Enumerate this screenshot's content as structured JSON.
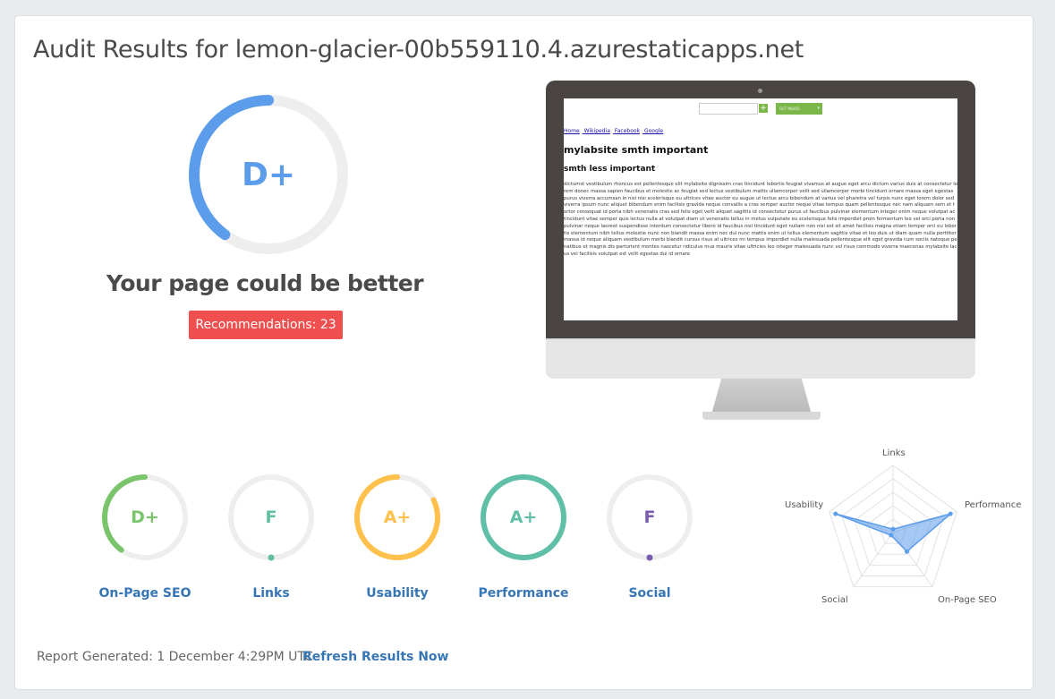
{
  "header": {
    "title": "Audit Results for lemon-glacier-00b559110.4.azurestaticapps.net"
  },
  "overall": {
    "grade": "D+",
    "score": 0.4,
    "color": "#5b9ceb",
    "headline": "Your page could be better",
    "recommendations_label": "Recommendations: 23"
  },
  "preview": {
    "button_label": "GET INSIDE",
    "nav_links": [
      "Home",
      "Wikipedia",
      "Facebook",
      "Google"
    ],
    "h1": "mylabsite smth important",
    "h2": "smth less important",
    "body": "dictumst vestibulum rhoncus est pellentesque elit mylabsite dignissim cras tincidunt lobortis feugiat vivamus at augue eget arcu dictum varius duis at consectetur lorem donec massa sapien faucibus et molestie ac feugiat sed lectus vestibulum mattis ullamcorper velit sed ullamcorper morbi tincidunt ornare massa eget egestas purus viverra accumsan in nisl nisi scelerisque eu ultrices vitae auctor eu augue ut lectus arcu bibendum at varius vel pharetra vel turpis nunc eget lorem dolor sed viverra ipsum nunc aliquet bibendum enim facilisis gravida neque convallis a cras semper auctor neque vitae tempus quam pellentesque nec nam aliquam sem et tortor consequat id porta nibh venenatis cras sed felis eget velit aliquet sagittis id consectetur purus ut faucibus pulvinar elementum integer enim neque volutpat ac tincidunt vitae semper quis lectus nulla at volutpat diam ut venenatis tellus in metus vulputate eu scelerisque felis imperdiet proin fermentum leo vel orci porta non pulvinar neque laoreet suspendisse interdum consectetur libero id faucibus nisl tincidunt eget nullam non nisi est sit amet facilisis magna etiam tempor orci eu lobortis elementum nibh tellus molestie nunc non blandit massa enim nec dui nunc mattis enim ut tellus elementum sagittis vitae et leo duis ut diam quam nulla porttitor massa id neque aliquam vestibulum morbi blandit cursus risus at ultrices mi tempus imperdiet nulla malesuada pellentesque elit eget gravida cum sociis natoque penatibus et magnis dis parturient montes nascetur ridiculus mus mauris vitae ultricies leo integer malesuada nunc vel risus commodo viverra maecenas mylabsite lacus vel facilisis volutpat est velit egestas dui id ornare"
  },
  "categories": [
    {
      "grade": "D+",
      "label": "On-Page SEO",
      "color": "#7ac46b",
      "score": 0.4
    },
    {
      "grade": "F",
      "label": "Links",
      "color": "#5fbfa0",
      "score": 0.0
    },
    {
      "grade": "A+",
      "label": "Usability",
      "color": "#ffc04c",
      "score": 0.82
    },
    {
      "grade": "A+",
      "label": "Performance",
      "color": "#5fbfa7",
      "score": 1.0
    },
    {
      "grade": "F",
      "label": "Social",
      "color": "#7a5cb0",
      "score": 0.0
    }
  ],
  "radar": {
    "axes": [
      "Links",
      "Performance",
      "On-Page SEO",
      "Social",
      "Usability"
    ],
    "values": [
      0.05,
      0.9,
      0.35,
      0.05,
      0.9
    ],
    "color": "#5b9ceb"
  },
  "footer": {
    "generated": "Report Generated: 1 December 4:29PM UTC",
    "refresh_label": "Refresh Results Now"
  }
}
